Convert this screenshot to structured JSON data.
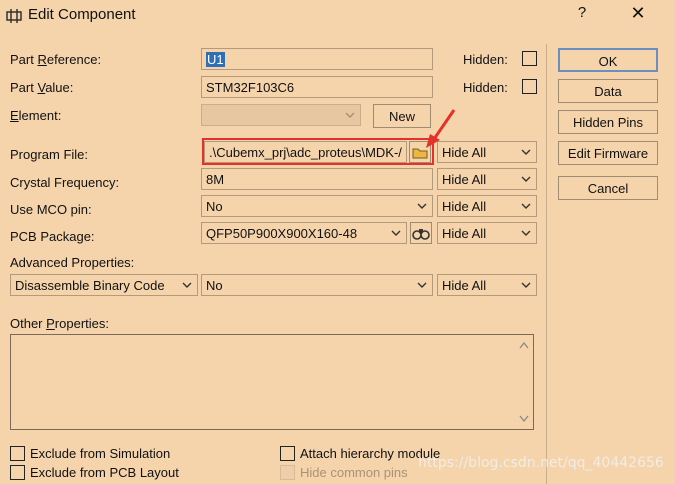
{
  "window": {
    "title": "Edit Component",
    "help_label": "?",
    "close_label": "✕"
  },
  "form": {
    "part_reference": {
      "label": "Part Reference:",
      "value": "U1",
      "hidden_label": "Hidden:"
    },
    "part_value": {
      "label": "Part Value:",
      "value": "STM32F103C6",
      "hidden_label": "Hidden:"
    },
    "element": {
      "label": "Element:",
      "value": "",
      "new_label": "New"
    },
    "program_file": {
      "label": "Program File:",
      "value": ".\\Cubemx_prj\\adc_proteus\\MDK-/",
      "visibility": "Hide All"
    },
    "crystal_frequency": {
      "label": "Crystal Frequency:",
      "value": "8M",
      "visibility": "Hide All"
    },
    "use_mco_pin": {
      "label": "Use MCO pin:",
      "value": "No",
      "visibility": "Hide All"
    },
    "pcb_package": {
      "label": "PCB Package:",
      "value": "QFP50P900X900X160-48",
      "visibility": "Hide All"
    },
    "advanced_properties": {
      "label": "Advanced Properties:",
      "property": "Disassemble Binary Code",
      "value": "No",
      "visibility": "Hide All"
    },
    "other_properties": {
      "label": "Other Properties:",
      "value": ""
    }
  },
  "checkboxes": {
    "exclude_simulation": "Exclude from Simulation",
    "exclude_pcb": "Exclude from PCB Layout",
    "attach_hierarchy": "Attach hierarchy module",
    "hide_common_pins": "Hide common pins"
  },
  "buttons": {
    "ok": "OK",
    "data": "Data",
    "hidden_pins": "Hidden Pins",
    "edit_firmware": "Edit Firmware",
    "cancel": "Cancel"
  },
  "watermark": "https://blog.csdn.net/qq_40442656",
  "colors": {
    "background": "#f5d4ab",
    "highlight": "#e2322a",
    "selection": "#2f6fb5"
  }
}
